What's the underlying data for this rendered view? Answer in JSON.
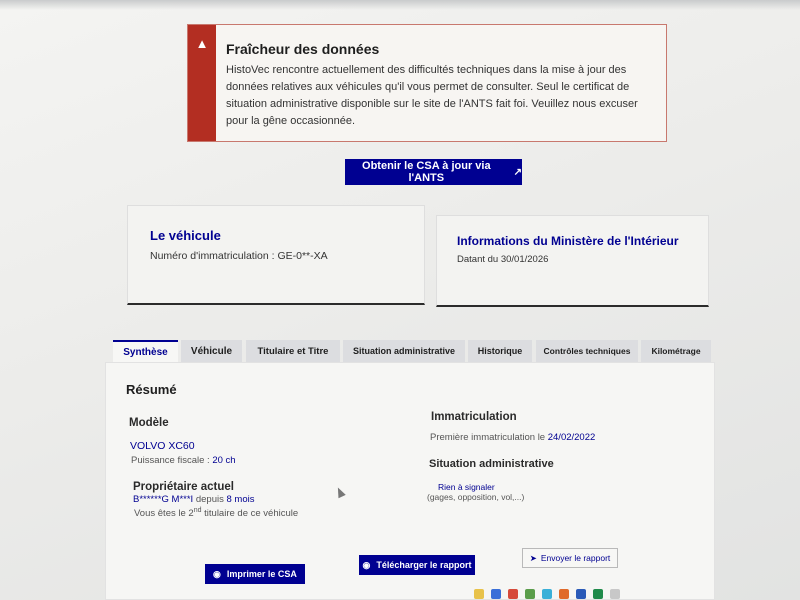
{
  "alert": {
    "icon": "warning-icon",
    "title": "Fraîcheur des données",
    "text": "HistoVec rencontre actuellement des difficultés techniques dans la mise à jour des données relatives aux véhicules qu'il vous permet de consulter. Seul le certificat de situation administrative disponible sur le site de l'ANTS fait foi. Veuillez nous excuser pour la gêne occasionnée."
  },
  "csa_button": {
    "label": "Obtenir le CSA à jour via l'ANTS",
    "icon": "external-link-icon"
  },
  "vehicle_card": {
    "title": "Le véhicule",
    "plate_label": "Numéro d'immatriculation :",
    "plate_value": "GE-0**-XA"
  },
  "ministry_card": {
    "title": "Informations du Ministère de l'Intérieur",
    "date_text": "Datant du 30/01/2026"
  },
  "tabs": [
    {
      "label": "Synthèse",
      "active": true
    },
    {
      "label": "Véhicule",
      "active": false
    },
    {
      "label": "Titulaire et Titre",
      "active": false
    },
    {
      "label": "Situation administrative",
      "active": false
    },
    {
      "label": "Historique",
      "active": false
    },
    {
      "label": "Contrôles techniques",
      "active": false
    },
    {
      "label": "Kilométrage",
      "active": false
    }
  ],
  "summary": {
    "heading": "Résumé",
    "model": {
      "heading": "Modèle",
      "name": "VOLVO XC60",
      "power_label": "Puissance fiscale :",
      "power_value": "20 ch"
    },
    "owner": {
      "heading": "Propriétaire actuel",
      "name": "B******G M***I",
      "since_label": "depuis",
      "since_value": "8 mois",
      "rank_prefix": "Vous êtes le",
      "rank_number": "2",
      "rank_suffix": "nd",
      "rank_rest": "titulaire de ce véhicule"
    },
    "registration": {
      "heading": "Immatriculation",
      "first_label": "Première immatriculation le",
      "first_value": "24/02/2022"
    },
    "admin": {
      "heading": "Situation administrative",
      "status": "Rien à signaler",
      "detail": "(gages, opposition, vol,...)"
    }
  },
  "actions": {
    "print_label": "Imprimer le CSA",
    "download_label": "Télécharger le rapport",
    "send_label": "Envoyer le rapport"
  },
  "colors": {
    "primary": "#000091",
    "alert_red": "#b32e22"
  }
}
